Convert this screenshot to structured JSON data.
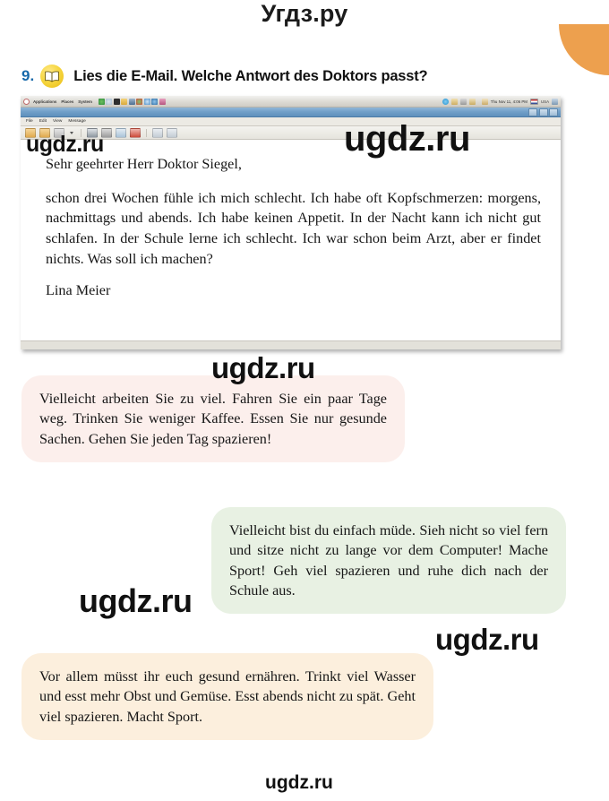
{
  "page": {
    "header_watermark": "Угдз.ру",
    "watermarks": [
      "ugdz.ru",
      "ugdz.ru",
      "ugdz.ru",
      "ugdz.ru",
      "ugdz.ru",
      "ugdz.ru"
    ],
    "accent_orange": "#eda04e",
    "exercise_number_color": "#1769aa"
  },
  "task": {
    "number": "9.",
    "icon": "open-book-icon",
    "instruction": "Lies die E-Mail. Welche Antwort des Doktors passt?"
  },
  "screenshot": {
    "taskbar": {
      "menus": [
        "Applications",
        "Places",
        "System"
      ],
      "clock": "Thu Nov 11,  4:06 PM",
      "keyboard_layout": "USA"
    },
    "window": {
      "title": "",
      "menubar": [
        "File",
        "Edit",
        "View",
        "Message"
      ],
      "toolbar_buttons": [
        "reply-icon",
        "reply-all-icon",
        "forward-icon",
        "dropdown-caret-icon",
        "print-icon",
        "archive-icon",
        "folder-icon",
        "junk-icon",
        "previous-icon",
        "next-icon"
      ],
      "window_buttons": [
        "minimize-button",
        "maximize-button",
        "close-button"
      ]
    },
    "email": {
      "salutation": "Sehr geehrter Herr Doktor Siegel,",
      "body": "schon drei Wochen fühle ich mich schlecht. Ich habe oft Kopfschmerzen: morgens, nachmittags und abends. Ich habe keinen Appetit. In der Nacht kann ich nicht gut schlafen. In der Schule lerne ich schlecht. Ich war schon beim Arzt, aber er findet nichts. Was soll ich machen?",
      "signature": "Lina Meier"
    }
  },
  "answers": [
    {
      "id": "answer-1",
      "color": "#fcefec",
      "text": "Vielleicht arbeiten Sie zu viel. Fahren Sie ein paar Tage weg. Trinken Sie weniger Kaffee. Essen Sie nur gesunde Sachen. Gehen Sie jeden Tag spazieren!"
    },
    {
      "id": "answer-2",
      "color": "#e8f1e3",
      "text": "Vielleicht bist du einfach müde. Sieh nicht so viel fern und sitze nicht zu lange vor dem Computer! Mache Sport! Geh viel spazieren und ruhe dich nach der Schule aus."
    },
    {
      "id": "answer-3",
      "color": "#fcefdd",
      "text": "Vor allem müsst ihr euch gesund ernähren. Trinkt viel Wasser und esst mehr Obst und Gemüse. Esst abends nicht zu spät. Geht viel spazieren. Macht Sport."
    }
  ]
}
